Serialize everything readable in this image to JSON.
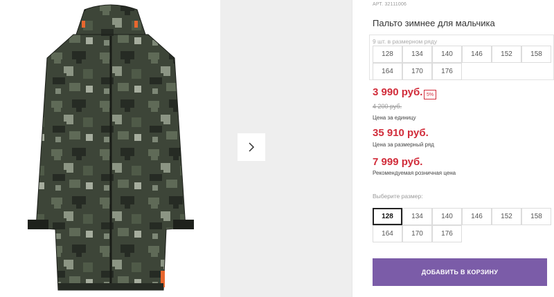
{
  "product": {
    "art_label": "АРТ.",
    "art_number": "32111006",
    "title": "Пальто зимнее для мальчика"
  },
  "stock": {
    "note": "9 шт. в размерном ряду",
    "sizes": [
      "128",
      "134",
      "140",
      "146",
      "152",
      "158",
      "164",
      "170",
      "176"
    ]
  },
  "pricing": {
    "price": "3 990 руб.",
    "discount": "5%",
    "old_price": "4 200 руб.",
    "unit_label": "Цена за единицу",
    "row_price": "35 910 руб.",
    "row_label": "Цена за размерный ряд",
    "rrp_price": "7 999 руб.",
    "rrp_label": "Рекомендуемая розничная цена"
  },
  "size_select": {
    "label": "Выберите размер:",
    "selected": "128",
    "sizes": [
      "128",
      "134",
      "140",
      "146",
      "152",
      "158",
      "164",
      "170",
      "176"
    ]
  },
  "cart": {
    "add_label": "ДОБАВИТЬ В КОРЗИНУ"
  },
  "gallery": {
    "next_icon": "chevron-right-icon"
  },
  "colors": {
    "price_red": "#d12c3a",
    "button_purple": "#7b5ca8"
  }
}
